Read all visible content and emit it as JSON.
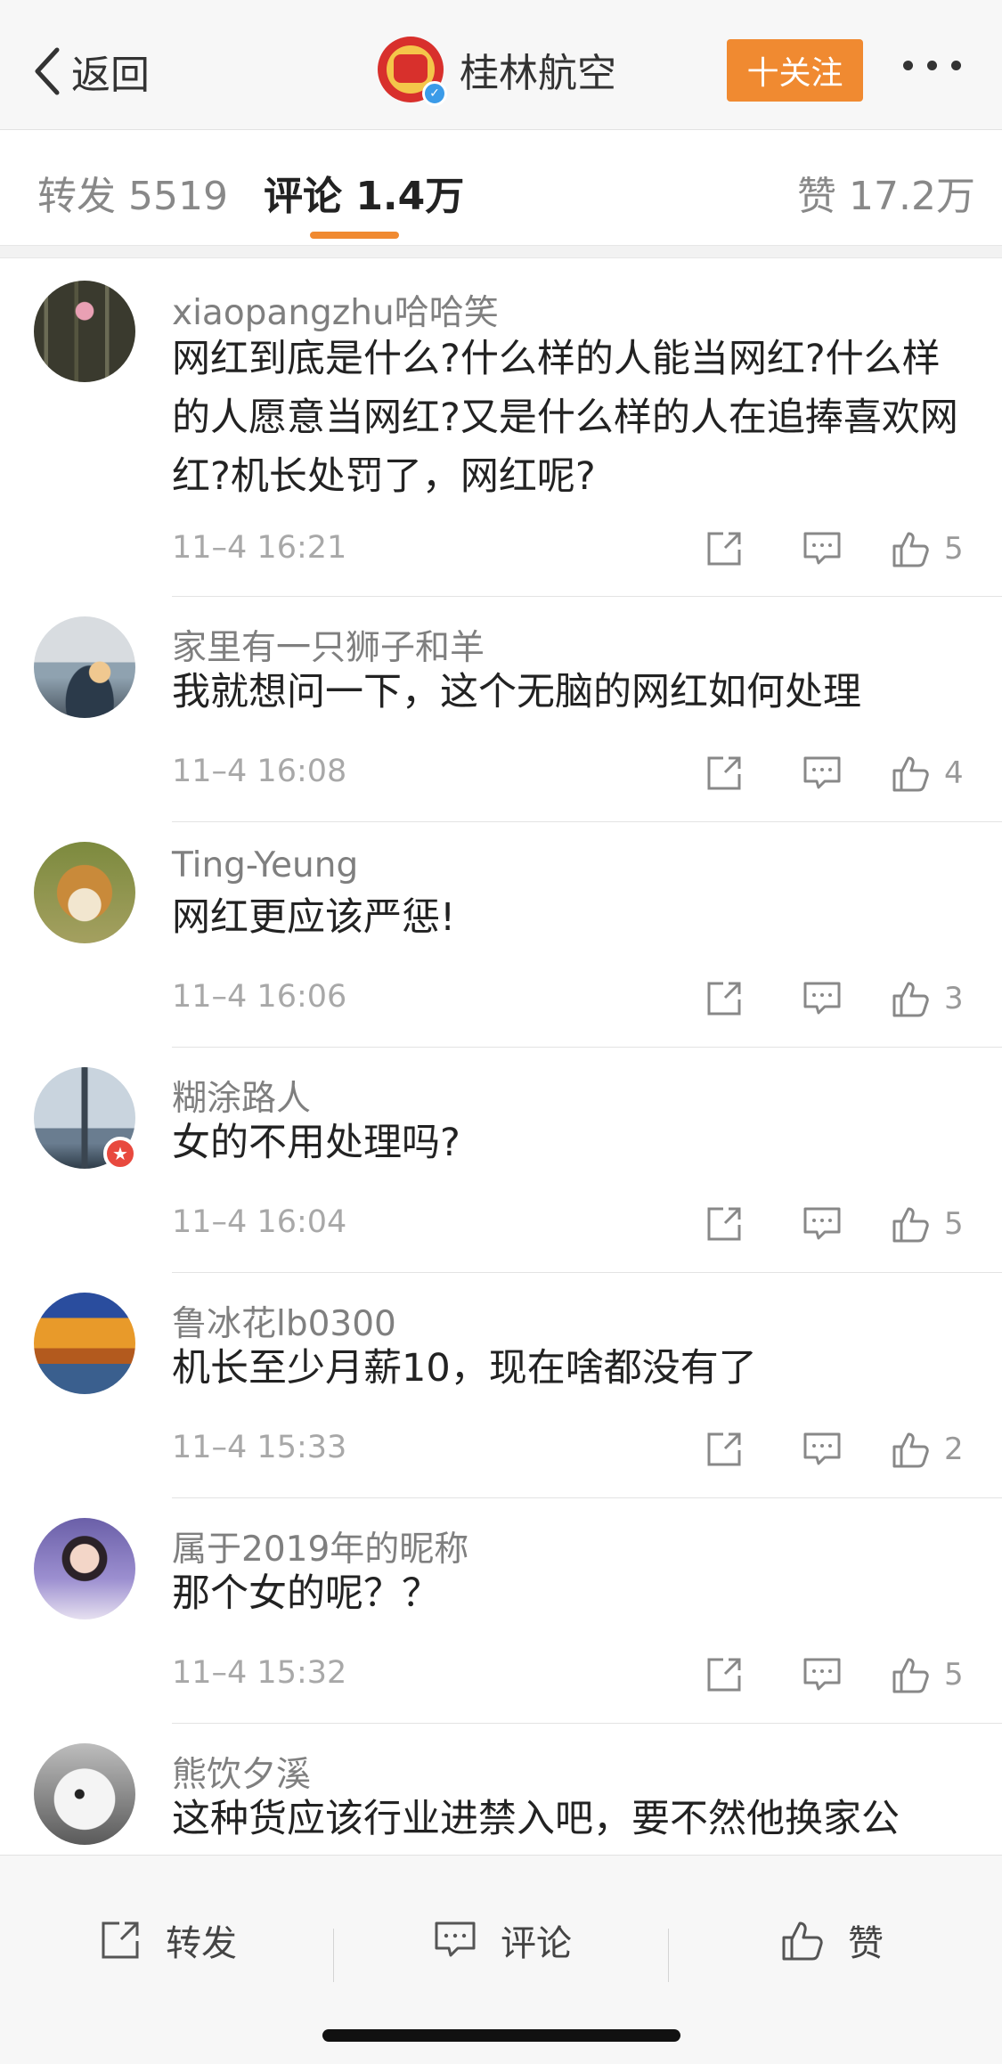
{
  "nav": {
    "back_label": "返回",
    "title": "桂林航空",
    "follow_label": "十关注"
  },
  "tabs": {
    "repost": "转发 5519",
    "comments": "评论 1.4万",
    "likes": "赞 17.2万"
  },
  "colors": {
    "accent": "#f08a31",
    "verified": "#3b9be8",
    "badge_red": "#e8493e"
  },
  "comments": [
    {
      "username": "xiaopangzhu哈哈笑",
      "text": "网红到底是什么?什么样的人能当网红?什么样的人愿意当网红?又是什么样的人在追捧喜欢网红?机长处罚了，网红呢?",
      "time": "11–4 16:21",
      "likes": "5",
      "avatar_icon": "avatar-person-in-forest"
    },
    {
      "username": "家里有一只狮子和羊",
      "text": "我就想问一下，这个无脑的网红如何处理",
      "time": "11–4 16:08",
      "likes": "4",
      "avatar_icon": "avatar-woman-by-lake"
    },
    {
      "username": "Ting-Yeung",
      "text": "网红更应该严惩!",
      "time": "11–4 16:06",
      "likes": "3",
      "avatar_icon": "avatar-fox"
    },
    {
      "username": "糊涂路人",
      "text": "女的不用处理吗?",
      "time": "11–4 16:04",
      "likes": "5",
      "avatar_icon": "avatar-bridge",
      "badge": "★"
    },
    {
      "username": "鲁冰花lb0300",
      "text": "机长至少月薪10，现在啥都没有了",
      "time": "11–4 15:33",
      "likes": "2",
      "avatar_icon": "avatar-autumn-trees"
    },
    {
      "username": "属于2019年的昵称",
      "text": "那个女的呢？？",
      "time": "11–4 15:32",
      "likes": "5",
      "avatar_icon": "avatar-girl"
    },
    {
      "username": "熊饮夕溪",
      "text": "这种货应该行业进禁入吧，要不然他换家公",
      "time": "",
      "likes": "",
      "avatar_icon": "avatar-polar-bear"
    }
  ],
  "bottom": {
    "repost_label": "转发",
    "comment_label": "评论",
    "like_label": "赞"
  }
}
